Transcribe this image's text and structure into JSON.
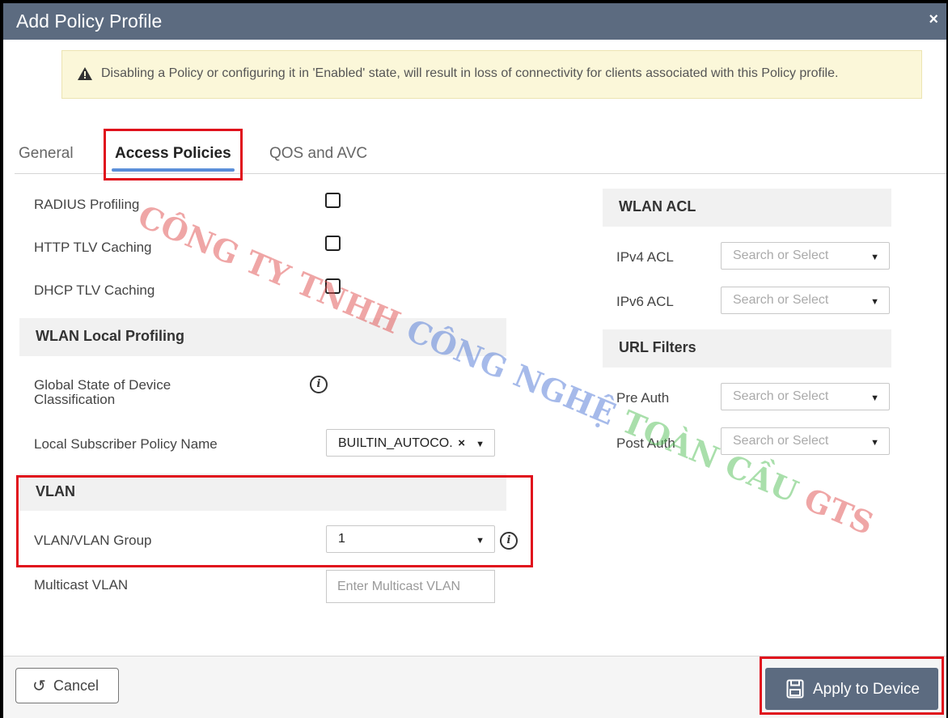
{
  "dialog": {
    "title": "Add Policy Profile",
    "close_glyph": "×"
  },
  "warning": {
    "text": "Disabling a Policy or configuring it in 'Enabled' state, will result in loss of connectivity for clients associated with this Policy profile."
  },
  "tabs": [
    {
      "label": "General"
    },
    {
      "label": "Access Policies"
    },
    {
      "label": "QOS and AVC"
    }
  ],
  "left": {
    "radius_profiling": "RADIUS Profiling",
    "http_tlv_caching": "HTTP TLV Caching",
    "dhcp_tlv_caching": "DHCP TLV Caching",
    "wlan_local_profiling": "WLAN Local Profiling",
    "global_state_line1": "Global State of Device",
    "global_state_line2": "Classification",
    "local_subscriber_label": "Local Subscriber Policy Name",
    "local_subscriber_value": "BUILTIN_AUTOCO.",
    "vlan_section": "VLAN",
    "vlan_group_label": "VLAN/VLAN Group",
    "vlan_group_value": "1",
    "multicast_label": "Multicast VLAN",
    "multicast_placeholder": "Enter Multicast VLAN"
  },
  "right": {
    "wlan_acl": "WLAN ACL",
    "ipv4_acl": "IPv4 ACL",
    "ipv6_acl": "IPv6 ACL",
    "url_filters": "URL Filters",
    "pre_auth": "Pre Auth",
    "post_auth": "Post Auth",
    "placeholder": "Search or Select"
  },
  "footer": {
    "cancel_label": "Cancel",
    "apply_label": "Apply to Device"
  },
  "watermark": {
    "part1": "CÔNG TY TNHH ",
    "part2": "CÔNG NGHỆ ",
    "part3": "TOÀN CẦU ",
    "part4": "GTS"
  },
  "colors": {
    "header": "#5c6b80",
    "accent_underline": "#5b8fd9",
    "highlight_box": "#e0101c",
    "warning_bg": "#fbf7d9"
  }
}
